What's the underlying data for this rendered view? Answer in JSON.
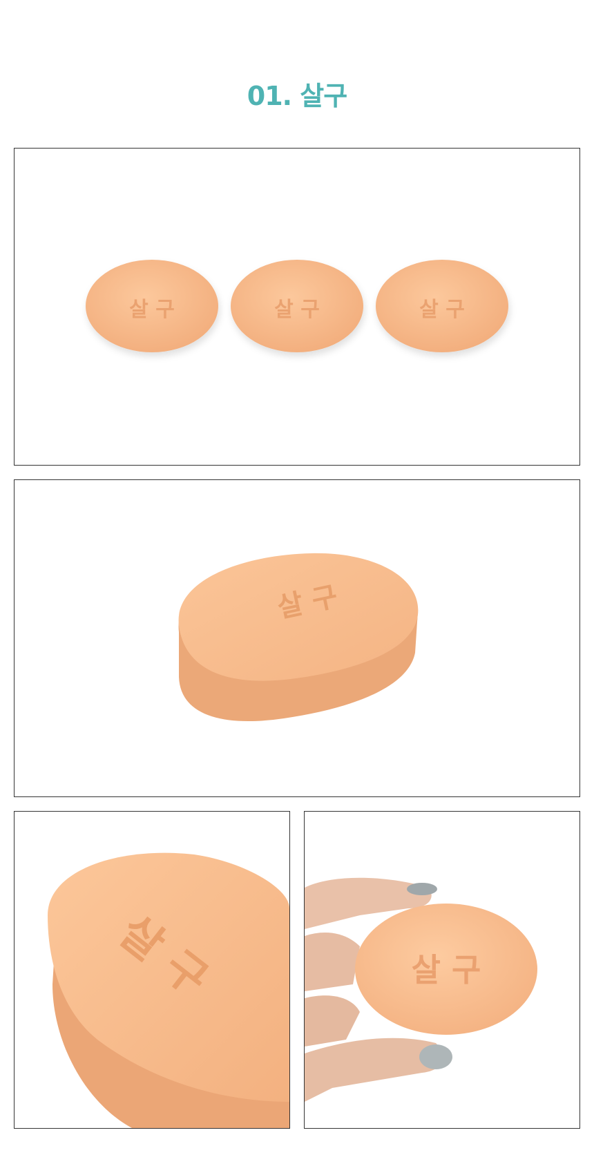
{
  "header": {
    "title": "01. 살구",
    "title_color": "#4fb3b3"
  },
  "product": {
    "emboss_text": "살 구",
    "soap_color": "#f8bc8e",
    "soap_side_color": "#e9a878"
  }
}
